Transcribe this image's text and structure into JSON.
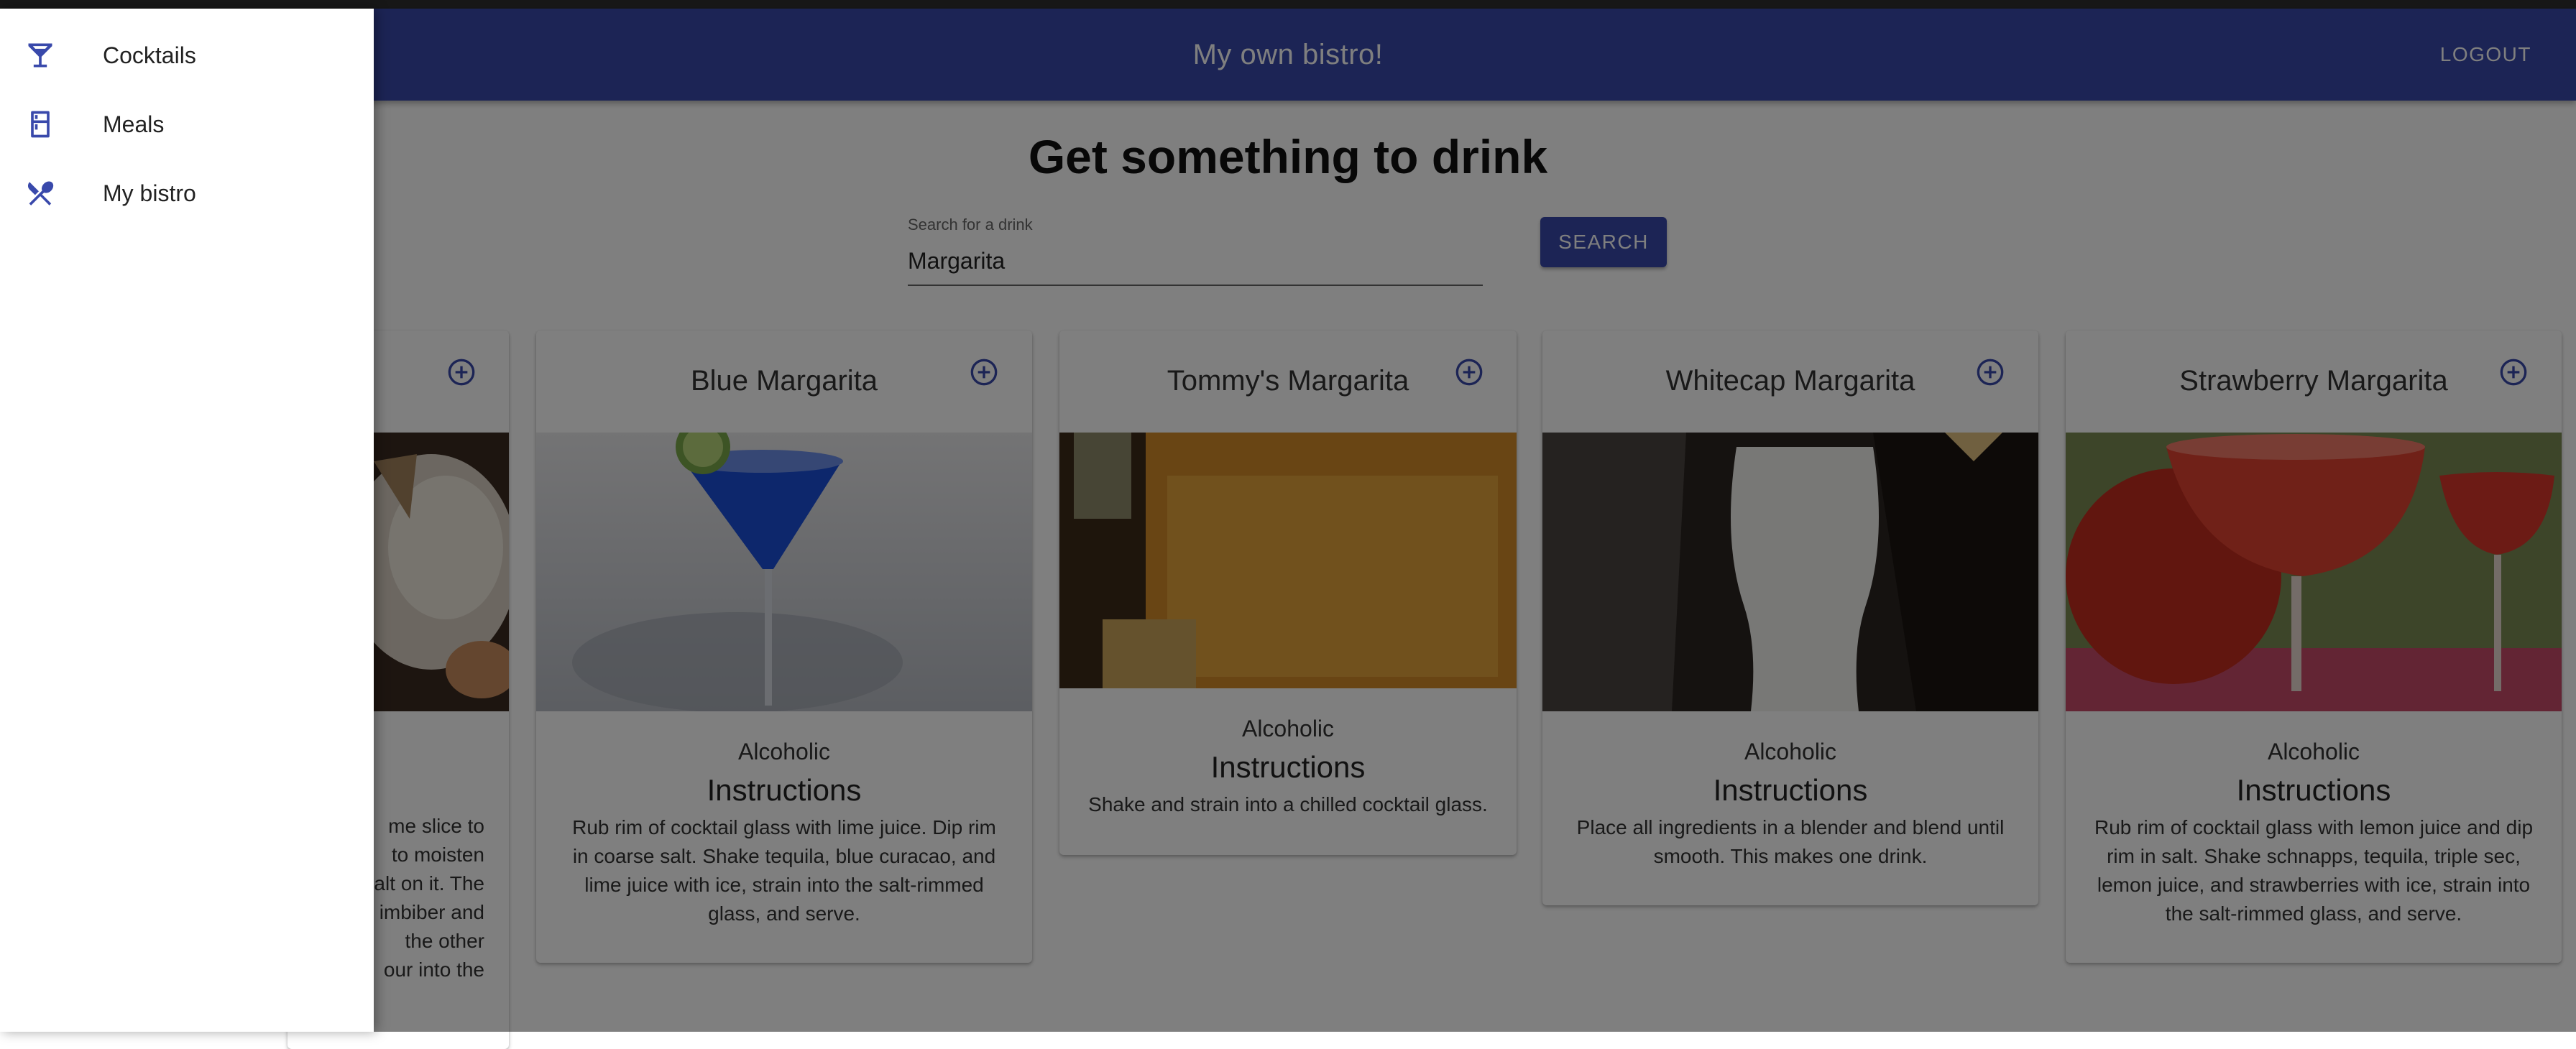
{
  "app": {
    "title": "My own bistro!",
    "logout_label": "LOGOUT"
  },
  "page": {
    "heading": "Get something to drink"
  },
  "search": {
    "label": "Search for a drink",
    "value": "Margarita",
    "button_label": "SEARCH"
  },
  "drawer": {
    "items": [
      {
        "label": "Cocktails",
        "icon": "cocktail-icon"
      },
      {
        "label": "Meals",
        "icon": "fridge-icon"
      },
      {
        "label": "My bistro",
        "icon": "utensils-icon"
      }
    ]
  },
  "cards": [
    {
      "title": "",
      "category": "",
      "instructions_heading": "",
      "instructions_fragments": [
        "me slice to",
        "to moisten",
        "alt on it. The",
        "imbiber and",
        "the other",
        "our into the"
      ]
    },
    {
      "title": "Blue Margarita",
      "category": "Alcoholic",
      "instructions_heading": "Instructions",
      "instructions": "Rub rim of cocktail glass with lime juice. Dip rim in coarse salt. Shake tequila, blue curacao, and lime juice with ice, strain into the salt-rimmed glass, and serve."
    },
    {
      "title": "Tommy's Margarita",
      "category": "Alcoholic",
      "instructions_heading": "Instructions",
      "instructions": "Shake and strain into a chilled cocktail glass."
    },
    {
      "title": "Whitecap Margarita",
      "category": "Alcoholic",
      "instructions_heading": "Instructions",
      "instructions": "Place all ingredients in a blender and blend until smooth. This makes one drink."
    },
    {
      "title": "Strawberry Margarita",
      "category": "Alcoholic",
      "instructions_heading": "Instructions",
      "instructions": "Rub rim of cocktail glass with lemon juice and dip rim in salt. Shake schnapps, tequila, triple sec, lemon juice, and strawberries with ice, strain into the salt-rimmed glass, and serve."
    }
  ],
  "colors": {
    "primary": "#3949ab",
    "overlay": "rgba(0,0,0,0.5)"
  }
}
